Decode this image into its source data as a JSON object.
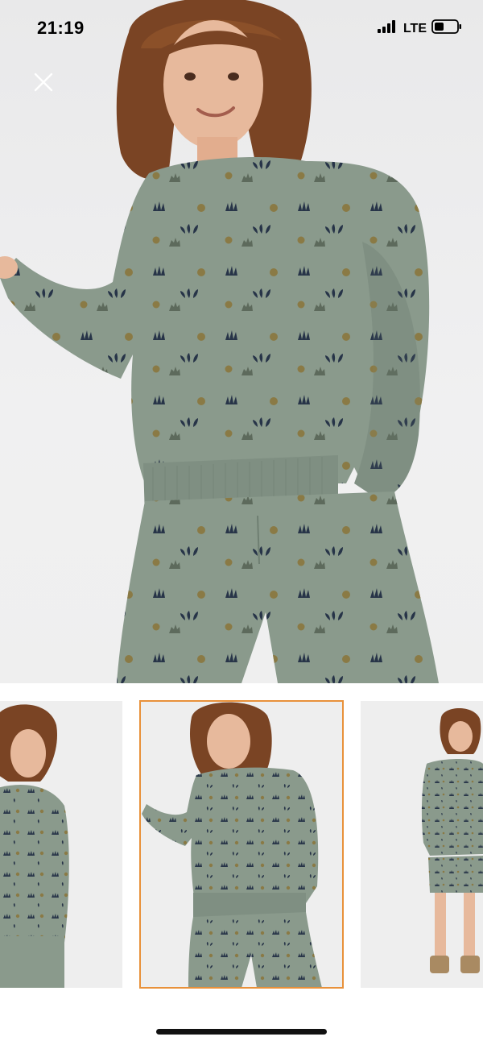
{
  "status_bar": {
    "time": "21:19",
    "network": "LTE",
    "icons": [
      "signal-icon",
      "battery-icon"
    ]
  },
  "header": {
    "close_icon": "close-icon"
  },
  "gallery": {
    "main_image": "product-photo-boy-green-printed-sweatshirt-and-shorts",
    "thumbnails": [
      {
        "name": "thumbnail-1",
        "selected": false
      },
      {
        "name": "thumbnail-2",
        "selected": true
      },
      {
        "name": "thumbnail-3",
        "selected": false
      }
    ],
    "accent_color": "#e8913a"
  },
  "colors": {
    "garment_green": "#8a9a8c",
    "print_navy": "#273448",
    "print_olive": "#8a7a45",
    "background": "#ededee"
  }
}
